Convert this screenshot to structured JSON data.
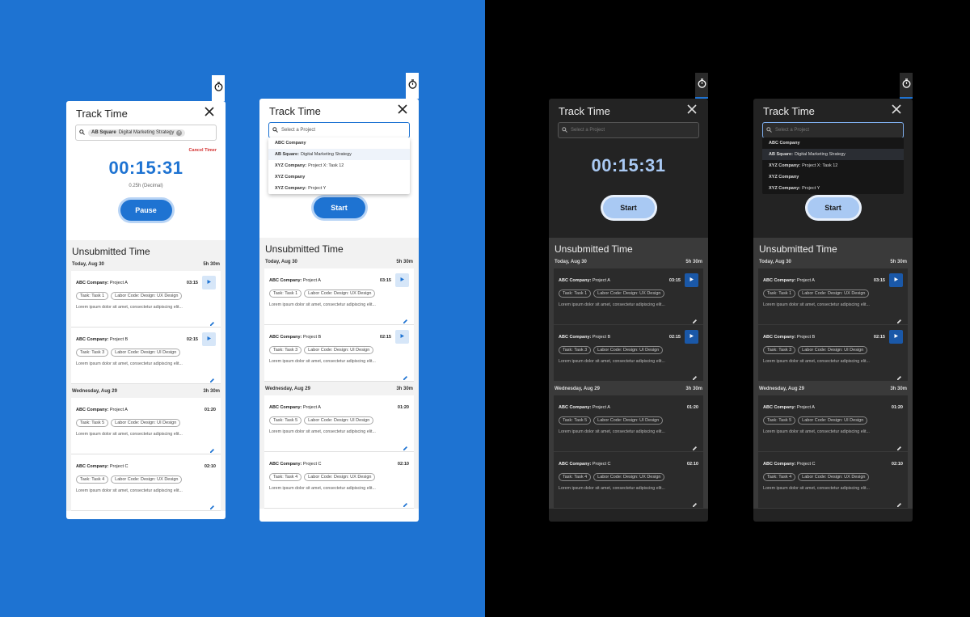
{
  "title": "Track Time",
  "search": {
    "placeholder": "Select a Project",
    "selected_company": "AB Square",
    "selected_project": "Digital Marketing Strategy"
  },
  "cancel_timer": "Cancel Timer",
  "timer_value": "00:15:31",
  "decimal_value": "0.25h (Decimal)",
  "pause_label": "Pause",
  "start_label": "Start",
  "dropdown": [
    {
      "company": "ABC Company",
      "project": ""
    },
    {
      "company": "AB Square:",
      "project": "Digital Marketing Strategy"
    },
    {
      "company": "XYZ Company:",
      "project": "Project X: Task 12"
    },
    {
      "company": "XYZ Company",
      "project": ""
    },
    {
      "company": "XYZ Company:",
      "project": "Project Y"
    }
  ],
  "unsubmitted_title": "Unsubmitted Time",
  "days": [
    {
      "label": "Today, Aug 30",
      "total": "5h 30m",
      "entries": [
        {
          "company": "ABC Company:",
          "project": "Project A",
          "time": "03:15",
          "task": "Task: Task 1",
          "labor": "Labor Code: Design: UX Design",
          "desc": "Lorem ipsum dolor sit amet, consectetur adipiscing elit..."
        },
        {
          "company": "ABC Company:",
          "project": "Project B",
          "time": "02:15",
          "task": "Task: Task 3",
          "labor": "Labor Code: Design: UI Design",
          "desc": "Lorem ipsum dolor sit amet, consectetur adipiscing elit..."
        }
      ]
    },
    {
      "label": "Wednesday, Aug 29",
      "total": "3h 30m",
      "entries": [
        {
          "company": "ABC Company:",
          "project": "Project A",
          "time": "01:20",
          "task": "Task: Task 5",
          "labor": "Labor Code: Design: UI Design",
          "desc": "Lorem ipsum dolor sit amet, consectetur adipiscing elit..."
        },
        {
          "company": "ABC Company:",
          "project": "Project C",
          "time": "02:10",
          "task": "Task: Task 4",
          "labor": "Labor Code: Design: UX Design",
          "desc": "Lorem ipsum dolor sit amet, consectetur adipiscing elit..."
        }
      ]
    }
  ],
  "colors": {
    "primary": "#1e73d2",
    "danger": "#d32f2f",
    "dark_panel": "#232323",
    "dark_body": "#3a3a3a"
  },
  "icons": [
    "stopwatch-icon",
    "close-icon",
    "search-icon",
    "clear-icon",
    "play-icon",
    "edit-icon"
  ]
}
